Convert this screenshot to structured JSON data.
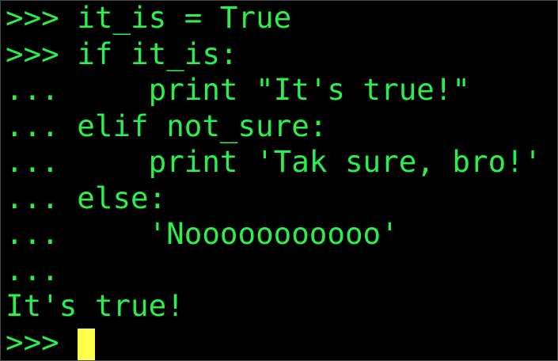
{
  "theme": {
    "background": "#000000",
    "text_color": "#2BEF4F",
    "cursor_color": "#FFFF4A"
  },
  "terminal": {
    "lines": [
      ">>> it_is = True",
      ">>> if it_is:",
      "...     print \"It's true!\"",
      "... elif not_sure:",
      "...     print 'Tak sure, bro!'",
      "... else:",
      "...     'Nooooooooooo'",
      "...",
      "It's true!"
    ],
    "prompt": ">>> "
  }
}
